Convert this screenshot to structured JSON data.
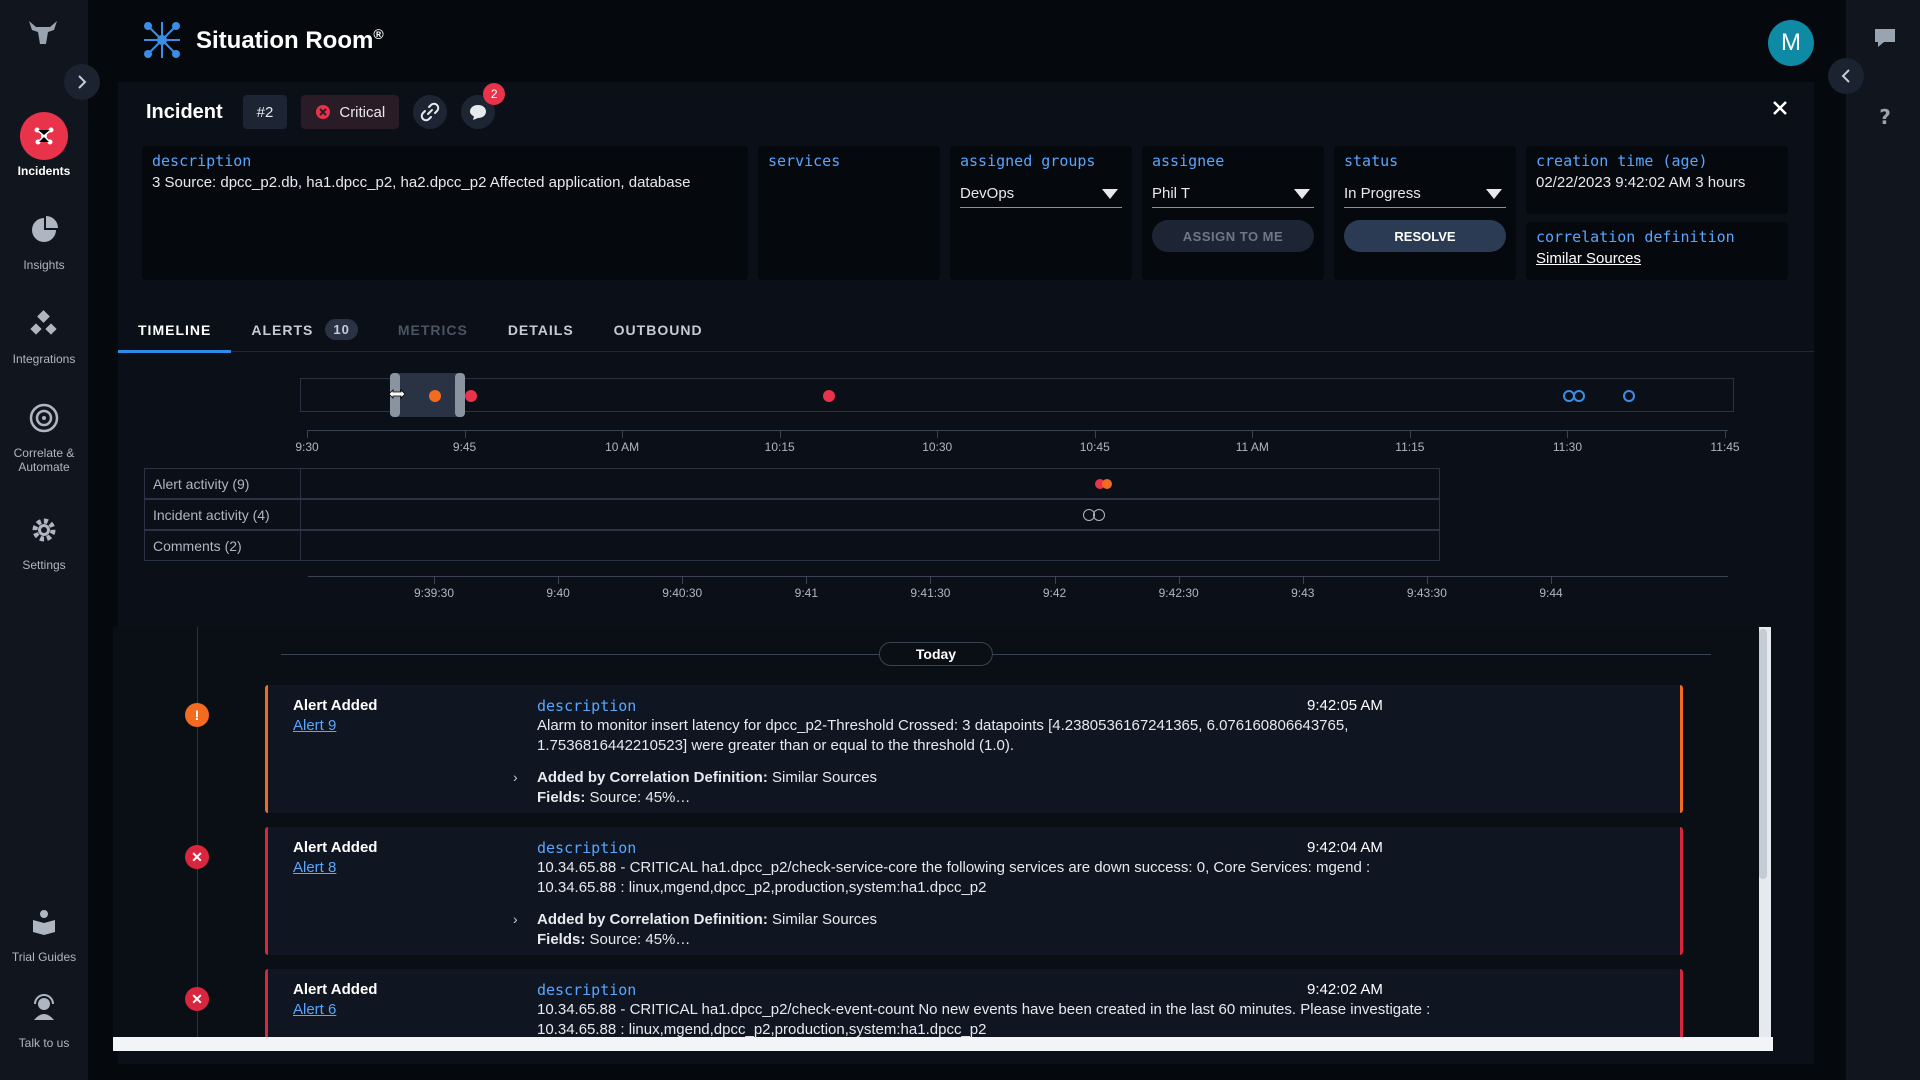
{
  "app": {
    "name": "Situation Room",
    "mark": "®",
    "user_initial": "M"
  },
  "nav": {
    "items": [
      {
        "label": "Incidents",
        "icon": "incidents-icon"
      },
      {
        "label": "Insights",
        "icon": "pie-chart-icon"
      },
      {
        "label": "Integrations",
        "icon": "integrations-icon"
      },
      {
        "label": "Correlate &",
        "label2": "Automate",
        "icon": "target-icon"
      },
      {
        "label": "Settings",
        "icon": "gear-icon"
      },
      {
        "label": "Trial Guides",
        "icon": "book-icon"
      },
      {
        "label": "Talk to us",
        "icon": "support-icon"
      }
    ]
  },
  "incident": {
    "title": "Incident",
    "number": "#2",
    "severity": "Critical",
    "comment_count": "2",
    "description_label": "description",
    "description": "3 Source: dpcc_p2.db, ha1.dpcc_p2, ha2.dpcc_p2 Affected application, database",
    "services_label": "services",
    "assigned_groups_label": "assigned groups",
    "assigned_groups": "DevOps",
    "assignee_label": "assignee",
    "assignee": "Phil T",
    "assign_to_me": "ASSIGN TO ME",
    "status_label": "status",
    "status": "In Progress",
    "resolve": "RESOLVE",
    "creation_label": "creation time (age)",
    "creation_time": "02/22/2023 9:42:02 AM 3 hours",
    "correlation_label": "correlation definition",
    "correlation": "Similar Sources"
  },
  "tabs": [
    {
      "label": "TIMELINE",
      "state": "active"
    },
    {
      "label": "ALERTS",
      "count": "10",
      "state": "normal"
    },
    {
      "label": "METRICS",
      "state": "disabled"
    },
    {
      "label": "DETAILS",
      "state": "normal"
    },
    {
      "label": "OUTBOUND",
      "state": "normal"
    }
  ],
  "timeline": {
    "overview_ticks": [
      "9:30",
      "9:45",
      "10 AM",
      "10:15",
      "10:30",
      "10:45",
      "11 AM",
      "11:15",
      "11:30",
      "11:45"
    ],
    "lanes": [
      "Alert activity (9)",
      "Incident activity (4)",
      "Comments (2)"
    ],
    "detail_ticks": [
      "9:39:30",
      "9:40",
      "9:40:30",
      "9:41",
      "9:41:30",
      "9:42",
      "9:42:30",
      "9:43",
      "9:43:30",
      "9:44"
    ]
  },
  "events": {
    "day_label": "Today",
    "items": [
      {
        "title": "Alert Added",
        "link": "Alert 9",
        "desc_label": "description",
        "desc": "Alarm to monitor insert latency for dpcc_p2-Threshold Crossed: 3 datapoints [4.2380536167241365, 6.076160806643765, 1.7536816442210523] were greater than or equal to the threshold (1.0).",
        "time": "9:42:05 AM",
        "corr_label": "Added by Correlation Definition:",
        "corr": "Similar Sources",
        "fields_label": "Fields:",
        "fields": "Source: 45%…",
        "level": "warning",
        "color": "#f26b21"
      },
      {
        "title": "Alert Added",
        "link": "Alert 8",
        "desc_label": "description",
        "desc": "10.34.65.88 - CRITICAL ha1.dpcc_p2/check-service-core the following services are down success: 0, Core Services: mgend : 10.34.65.88 : linux,mgend,dpcc_p2,production,system:ha1.dpcc_p2",
        "time": "9:42:04 AM",
        "corr_label": "Added by Correlation Definition:",
        "corr": "Similar Sources",
        "fields_label": "Fields:",
        "fields": "Source: 45%…",
        "level": "critical",
        "color": "#d7263d"
      },
      {
        "title": "Alert Added",
        "link": "Alert 6",
        "desc_label": "description",
        "desc": "10.34.65.88 - CRITICAL ha1.dpcc_p2/check-event-count No new events have been created in the last 60 minutes. Please investigate : 10.34.65.88 : linux,mgend,dpcc_p2,production,system:ha1.dpcc_p2",
        "time": "9:42:02 AM",
        "level": "critical",
        "color": "#d7263d"
      }
    ]
  }
}
